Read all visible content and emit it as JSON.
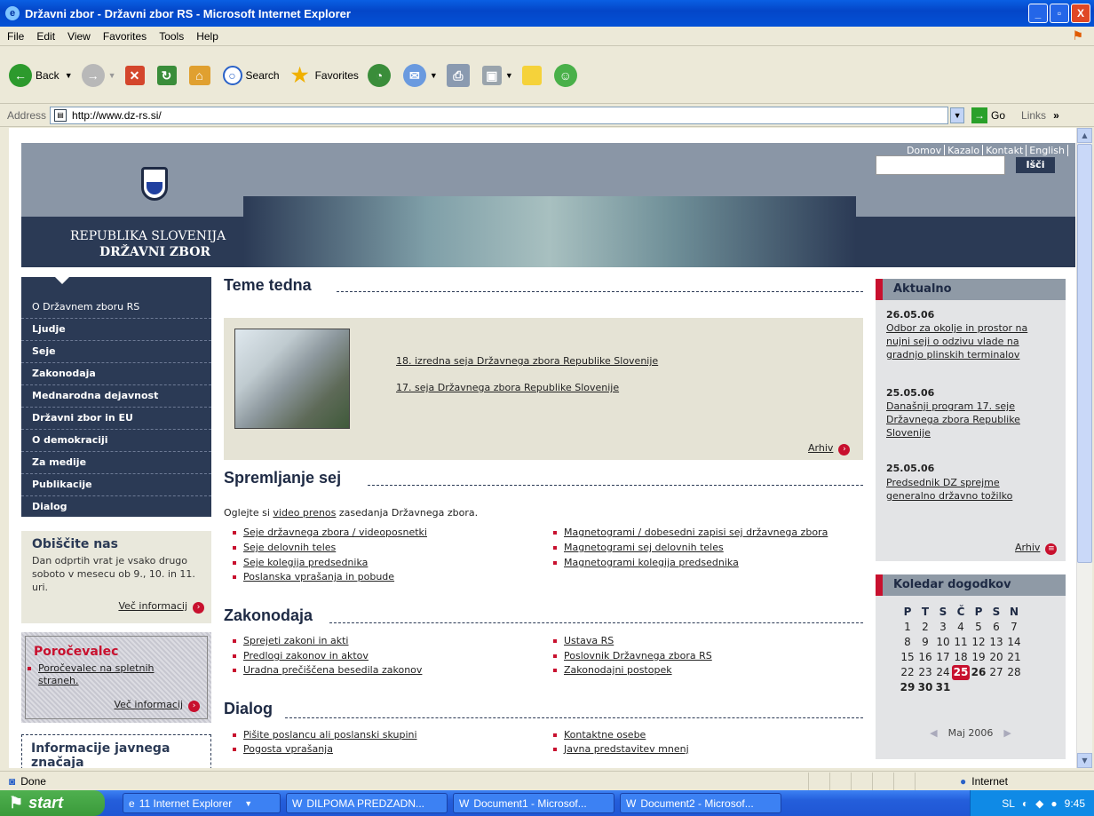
{
  "window": {
    "title": "Državni zbor - Državni zbor RS - Microsoft Internet Explorer",
    "buttons": [
      "_",
      "▫",
      "X"
    ]
  },
  "menu": [
    "File",
    "Edit",
    "View",
    "Favorites",
    "Tools",
    "Help"
  ],
  "toolbar": {
    "back": "Back",
    "search": "Search",
    "favorites": "Favorites"
  },
  "address": {
    "label": "Address",
    "url": "http://www.dz-rs.si/",
    "go": "Go",
    "links": "Links"
  },
  "header": {
    "brand_line1": "REPUBLIKA SLOVENIJA",
    "brand_line2": "DRŽAVNI ZBOR",
    "toplinks": [
      "Domov",
      "Kazalo",
      "Kontakt",
      "English"
    ],
    "search_button": "Išči"
  },
  "leftnav": [
    "O Državnem zboru RS",
    "Ljudje",
    "Seje",
    "Zakonodaja",
    "Mednarodna dejavnost",
    "Državni zbor in EU",
    "O demokraciji",
    "Za medije",
    "Publikacije",
    "Dialog"
  ],
  "visit": {
    "title": "Obiščite nas",
    "text": "Dan odprtih vrat je vsako drugo soboto v mesecu ob 9., 10. in 11. uri.",
    "more": "Več informacij"
  },
  "porocevalec": {
    "title": "Poročevalec",
    "item": "Poročevalec na spletnih straneh.",
    "more": "Več informacij"
  },
  "ijz": {
    "title": "Informacije javnega značaja"
  },
  "teme": {
    "title": "Teme tedna",
    "links": [
      "18. izredna seja Državnega zbora Republike Slovenije",
      "17. seja Državnega zbora Republike Slovenije"
    ],
    "archive": "Arhiv"
  },
  "spremljanje": {
    "title": "Spremljanje sej",
    "intro_pre": "Oglejte si ",
    "intro_link": "video prenos",
    "intro_post": " zasedanja Državnega zbora.",
    "col1": [
      "Seje državnega zbora / videoposnetki",
      "Seje delovnih teles",
      "Seje kolegija predsednika",
      "Poslanska vprašanja in pobude"
    ],
    "col2": [
      "Magnetogrami / dobesedni zapisi sej državnega zbora",
      "Magnetogrami sej delovnih teles",
      "Magnetogrami kolegija predsednika"
    ]
  },
  "zakonodaja": {
    "title": "Zakonodaja",
    "col1": [
      "Sprejeti zakoni in akti",
      "Predlogi zakonov in aktov",
      "Uradna prečiščena besedila zakonov"
    ],
    "col2": [
      "Ustava RS",
      "Poslovnik Državnega zbora RS",
      "Zakonodajni postopek"
    ]
  },
  "dialog": {
    "title": "Dialog",
    "col1": [
      "Pišite poslancu ali poslanski skupini",
      "Pogosta vprašanja"
    ],
    "col2": [
      "Kontaktne osebe",
      "Javna predstavitev mnenj"
    ]
  },
  "aktualno": {
    "title": "Aktualno",
    "items": [
      {
        "date": "26.05.06",
        "text": "Odbor za okolje in prostor na nujni seji o odzivu vlade na gradnjo plinskih terminalov"
      },
      {
        "date": "25.05.06",
        "text": "Današnji program 17. seje Državnega zbora Republike Slovenije"
      },
      {
        "date": "25.05.06",
        "text": "Predsednik DZ sprejme generalno državno tožilko"
      }
    ],
    "archive": "Arhiv"
  },
  "koledar": {
    "title": "Koledar dogodkov",
    "days": [
      "P",
      "T",
      "S",
      "Č",
      "P",
      "S",
      "N"
    ],
    "weeks": [
      [
        "1",
        "2",
        "3",
        "4",
        "5",
        "6",
        "7"
      ],
      [
        "8",
        "9",
        "10",
        "11",
        "12",
        "13",
        "14"
      ],
      [
        "15",
        "16",
        "17",
        "18",
        "19",
        "20",
        "21"
      ],
      [
        "22",
        "23",
        "24",
        "25",
        "26",
        "27",
        "28"
      ],
      [
        "29",
        "30",
        "31",
        "",
        "",
        "",
        ""
      ]
    ],
    "today": "25",
    "month": "Maj 2006"
  },
  "status": {
    "left": "Done",
    "zone": "Internet"
  },
  "taskbar": {
    "start": "start",
    "tasks": [
      "11 Internet Explorer",
      "DILPOMA PREDZADN...",
      "Document1 - Microsof...",
      "Document2 - Microsof..."
    ],
    "lang": "SL",
    "time": "9:45"
  }
}
